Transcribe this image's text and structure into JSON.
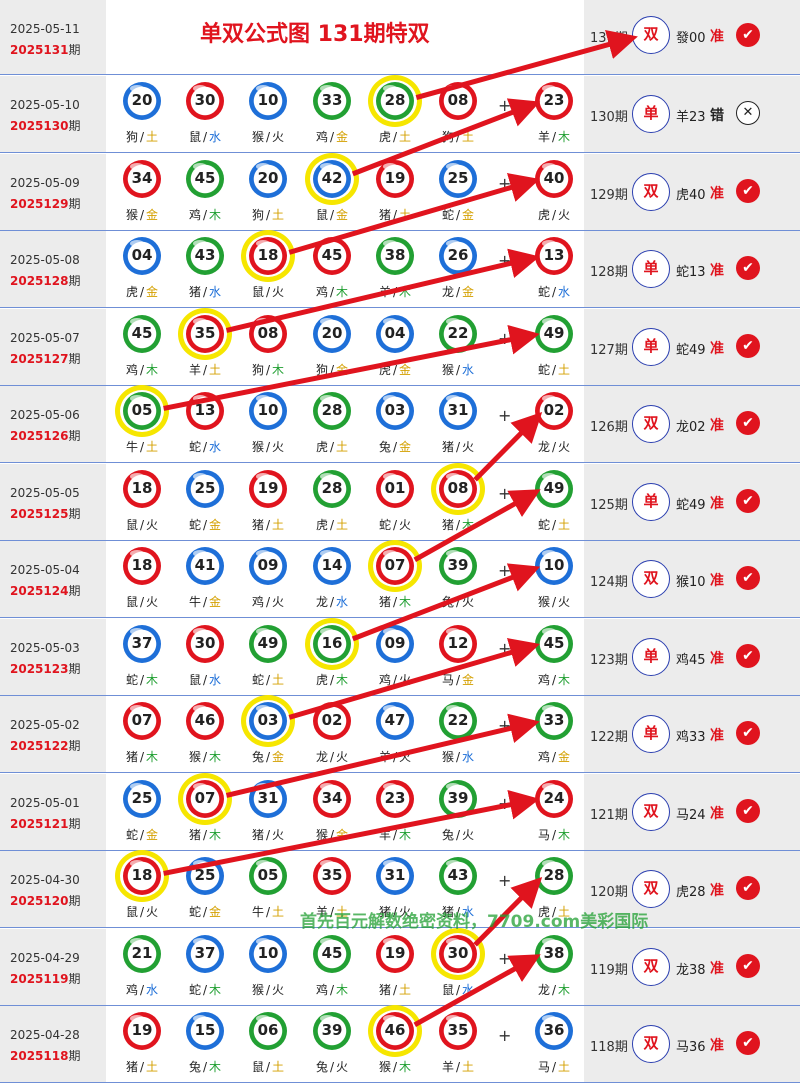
{
  "header": {
    "title": "单双公式图 131期特双",
    "date": "2025-05-11",
    "issue": "2025131",
    "issue_suffix": "期",
    "result": {
      "issue": "131期",
      "pick": "双",
      "value": "發00",
      "status": "准"
    }
  },
  "plus_sign": "+",
  "separator": "/",
  "colors": {
    "red": "#e0141e",
    "blue": "#1e6fd8",
    "green": "#22a033",
    "highlight": "#f6e600",
    "wood": "#22a033",
    "water": "#1e6fd8",
    "fire": "#222222",
    "metal": "#d4a000",
    "earth": "#d4a000"
  },
  "rows": [
    {
      "date": "2025-05-10",
      "issue": "2025130",
      "qi": "期",
      "rc_issue": "130期",
      "pick": "单",
      "result": "羊23",
      "status": "错",
      "correct": false,
      "hl": 4,
      "balls": [
        [
          "20",
          "blue",
          "狗",
          "土"
        ],
        [
          "30",
          "red",
          "鼠",
          "水"
        ],
        [
          "10",
          "blue",
          "猴",
          "火"
        ],
        [
          "33",
          "green",
          "鸡",
          "金"
        ],
        [
          "28",
          "green",
          "虎",
          "土"
        ],
        [
          "08",
          "red",
          "狗",
          "土"
        ],
        [
          "23",
          "red",
          "羊",
          "木"
        ]
      ]
    },
    {
      "date": "2025-05-09",
      "issue": "2025129",
      "qi": "期",
      "rc_issue": "129期",
      "pick": "双",
      "result": "虎40",
      "status": "准",
      "correct": true,
      "hl": 3,
      "balls": [
        [
          "34",
          "red",
          "猴",
          "金"
        ],
        [
          "45",
          "green",
          "鸡",
          "木"
        ],
        [
          "20",
          "blue",
          "狗",
          "土"
        ],
        [
          "42",
          "blue",
          "鼠",
          "金"
        ],
        [
          "19",
          "red",
          "猪",
          "土"
        ],
        [
          "25",
          "blue",
          "蛇",
          "金"
        ],
        [
          "40",
          "red",
          "虎",
          "火"
        ]
      ]
    },
    {
      "date": "2025-05-08",
      "issue": "2025128",
      "qi": "期",
      "rc_issue": "128期",
      "pick": "单",
      "result": "蛇13",
      "status": "准",
      "correct": true,
      "hl": 2,
      "balls": [
        [
          "04",
          "blue",
          "虎",
          "金"
        ],
        [
          "43",
          "green",
          "猪",
          "水"
        ],
        [
          "18",
          "red",
          "鼠",
          "火"
        ],
        [
          "45",
          "red",
          "鸡",
          "木"
        ],
        [
          "38",
          "green",
          "羊",
          "木"
        ],
        [
          "26",
          "blue",
          "龙",
          "金"
        ],
        [
          "13",
          "red",
          "蛇",
          "水"
        ]
      ]
    },
    {
      "date": "2025-05-07",
      "issue": "2025127",
      "qi": "期",
      "rc_issue": "127期",
      "pick": "单",
      "result": "蛇49",
      "status": "准",
      "correct": true,
      "hl": 1,
      "balls": [
        [
          "45",
          "green",
          "鸡",
          "木"
        ],
        [
          "35",
          "red",
          "羊",
          "土"
        ],
        [
          "08",
          "red",
          "狗",
          "木"
        ],
        [
          "20",
          "blue",
          "狗",
          "金"
        ],
        [
          "04",
          "blue",
          "虎",
          "金"
        ],
        [
          "22",
          "green",
          "猴",
          "水"
        ],
        [
          "49",
          "green",
          "蛇",
          "土"
        ]
      ]
    },
    {
      "date": "2025-05-06",
      "issue": "2025126",
      "qi": "期",
      "rc_issue": "126期",
      "pick": "双",
      "result": "龙02",
      "status": "准",
      "correct": true,
      "hl": 0,
      "balls": [
        [
          "05",
          "green",
          "牛",
          "土"
        ],
        [
          "13",
          "red",
          "蛇",
          "水"
        ],
        [
          "10",
          "blue",
          "猴",
          "火"
        ],
        [
          "28",
          "green",
          "虎",
          "土"
        ],
        [
          "03",
          "blue",
          "兔",
          "金"
        ],
        [
          "31",
          "blue",
          "猪",
          "火"
        ],
        [
          "02",
          "red",
          "龙",
          "火"
        ]
      ]
    },
    {
      "date": "2025-05-05",
      "issue": "2025125",
      "qi": "期",
      "rc_issue": "125期",
      "pick": "单",
      "result": "蛇49",
      "status": "准",
      "correct": true,
      "hl": 5,
      "balls": [
        [
          "18",
          "red",
          "鼠",
          "火"
        ],
        [
          "25",
          "blue",
          "蛇",
          "金"
        ],
        [
          "19",
          "red",
          "猪",
          "土"
        ],
        [
          "28",
          "green",
          "虎",
          "土"
        ],
        [
          "01",
          "red",
          "蛇",
          "火"
        ],
        [
          "08",
          "red",
          "猪",
          "木"
        ],
        [
          "49",
          "green",
          "蛇",
          "土"
        ]
      ]
    },
    {
      "date": "2025-05-04",
      "issue": "2025124",
      "qi": "期",
      "rc_issue": "124期",
      "pick": "双",
      "result": "猴10",
      "status": "准",
      "correct": true,
      "hl": 4,
      "balls": [
        [
          "18",
          "red",
          "鼠",
          "火"
        ],
        [
          "41",
          "blue",
          "牛",
          "金"
        ],
        [
          "09",
          "blue",
          "鸡",
          "火"
        ],
        [
          "14",
          "blue",
          "龙",
          "水"
        ],
        [
          "07",
          "red",
          "猪",
          "木"
        ],
        [
          "39",
          "green",
          "兔",
          "火"
        ],
        [
          "10",
          "blue",
          "猴",
          "火"
        ]
      ]
    },
    {
      "date": "2025-05-03",
      "issue": "2025123",
      "qi": "期",
      "rc_issue": "123期",
      "pick": "单",
      "result": "鸡45",
      "status": "准",
      "correct": true,
      "hl": 3,
      "balls": [
        [
          "37",
          "blue",
          "蛇",
          "木"
        ],
        [
          "30",
          "red",
          "鼠",
          "水"
        ],
        [
          "49",
          "green",
          "蛇",
          "土"
        ],
        [
          "16",
          "green",
          "虎",
          "木"
        ],
        [
          "09",
          "blue",
          "鸡",
          "火"
        ],
        [
          "12",
          "red",
          "马",
          "金"
        ],
        [
          "45",
          "green",
          "鸡",
          "木"
        ]
      ]
    },
    {
      "date": "2025-05-02",
      "issue": "2025122",
      "qi": "期",
      "rc_issue": "122期",
      "pick": "单",
      "result": "鸡33",
      "status": "准",
      "correct": true,
      "hl": 2,
      "balls": [
        [
          "07",
          "red",
          "猪",
          "木"
        ],
        [
          "46",
          "red",
          "猴",
          "木"
        ],
        [
          "03",
          "blue",
          "兔",
          "金"
        ],
        [
          "02",
          "red",
          "龙",
          "火"
        ],
        [
          "47",
          "blue",
          "羊",
          "火"
        ],
        [
          "22",
          "green",
          "猴",
          "水"
        ],
        [
          "33",
          "green",
          "鸡",
          "金"
        ]
      ]
    },
    {
      "date": "2025-05-01",
      "issue": "2025121",
      "qi": "期",
      "rc_issue": "121期",
      "pick": "双",
      "result": "马24",
      "status": "准",
      "correct": true,
      "hl": 1,
      "balls": [
        [
          "25",
          "blue",
          "蛇",
          "金"
        ],
        [
          "07",
          "red",
          "猪",
          "木"
        ],
        [
          "31",
          "blue",
          "猪",
          "火"
        ],
        [
          "34",
          "red",
          "猴",
          "金"
        ],
        [
          "23",
          "red",
          "羊",
          "木"
        ],
        [
          "39",
          "green",
          "兔",
          "火"
        ],
        [
          "24",
          "red",
          "马",
          "木"
        ]
      ]
    },
    {
      "date": "2025-04-30",
      "issue": "2025120",
      "qi": "期",
      "rc_issue": "120期",
      "pick": "双",
      "result": "虎28",
      "status": "准",
      "correct": true,
      "hl": 0,
      "balls": [
        [
          "18",
          "red",
          "鼠",
          "火"
        ],
        [
          "25",
          "blue",
          "蛇",
          "金"
        ],
        [
          "05",
          "green",
          "牛",
          "土"
        ],
        [
          "35",
          "red",
          "羊",
          "土"
        ],
        [
          "31",
          "blue",
          "猪",
          "火"
        ],
        [
          "43",
          "green",
          "猪",
          "水"
        ],
        [
          "28",
          "green",
          "虎",
          "土"
        ]
      ]
    },
    {
      "date": "2025-04-29",
      "issue": "2025119",
      "qi": "期",
      "rc_issue": "119期",
      "pick": "双",
      "result": "龙38",
      "status": "准",
      "correct": true,
      "hl": 5,
      "balls": [
        [
          "21",
          "green",
          "鸡",
          "水"
        ],
        [
          "37",
          "blue",
          "蛇",
          "木"
        ],
        [
          "10",
          "blue",
          "猴",
          "火"
        ],
        [
          "45",
          "green",
          "鸡",
          "木"
        ],
        [
          "19",
          "red",
          "猪",
          "土"
        ],
        [
          "30",
          "red",
          "鼠",
          "水"
        ],
        [
          "38",
          "green",
          "龙",
          "木"
        ]
      ]
    },
    {
      "date": "2025-04-28",
      "issue": "2025118",
      "qi": "期",
      "rc_issue": "118期",
      "pick": "双",
      "result": "马36",
      "status": "准",
      "correct": true,
      "hl": 4,
      "balls": [
        [
          "19",
          "red",
          "猪",
          "土"
        ],
        [
          "15",
          "blue",
          "兔",
          "木"
        ],
        [
          "06",
          "green",
          "鼠",
          "土"
        ],
        [
          "39",
          "green",
          "兔",
          "火"
        ],
        [
          "46",
          "red",
          "猴",
          "木"
        ],
        [
          "35",
          "red",
          "羊",
          "土"
        ],
        [
          "36",
          "blue",
          "马",
          "土"
        ]
      ]
    }
  ],
  "watermark": "首先百元解数绝密资料，7709.com美彩国际"
}
